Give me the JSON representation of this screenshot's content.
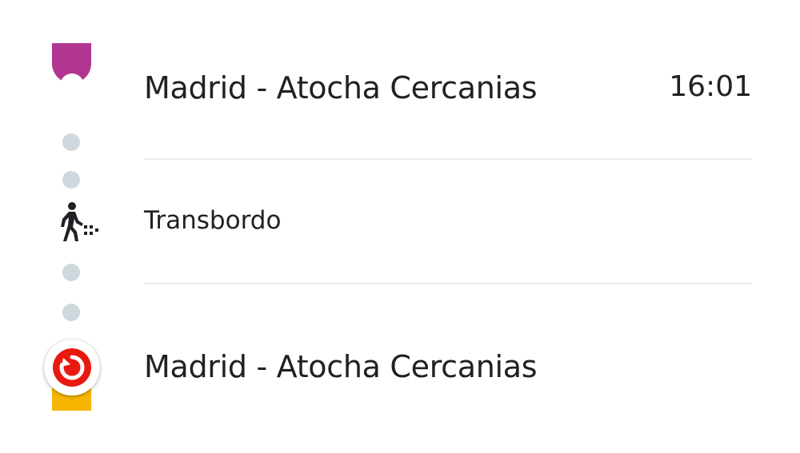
{
  "colors": {
    "line_top": "#b0368f",
    "line_bottom": "#f4b400",
    "stop_bottom_red": "#e8190f",
    "intermediate_dot": "#cfd8dc",
    "divider": "#e8eaed",
    "text": "#202124"
  },
  "departure": {
    "station": "Madrid - Atocha Cercanias",
    "time": "16:01",
    "icon": "stop-ring-icon"
  },
  "transfer": {
    "label": "Transbordo",
    "icon": "walking-transfer-icon"
  },
  "arrival": {
    "station": "Madrid - Atocha Cercanias",
    "icon": "cercanias-logo-icon"
  }
}
